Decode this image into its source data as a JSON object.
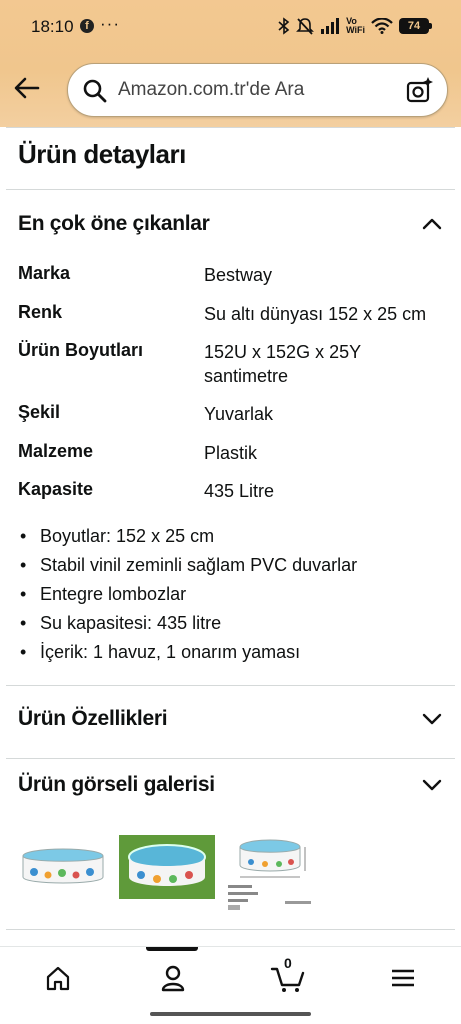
{
  "status_bar": {
    "time": "18:10",
    "app_icon": "f",
    "more": "···",
    "network_label_top": "Vo",
    "network_label_bottom": "WiFi",
    "battery": "74"
  },
  "search": {
    "placeholder": "Amazon.com.tr'de Ara"
  },
  "page": {
    "title": "Ürün detayları"
  },
  "highlights": {
    "title": "En çok öne çıkanlar",
    "specs": [
      {
        "key": "Marka",
        "value": "Bestway"
      },
      {
        "key": "Renk",
        "value": "Su altı dünyası 152 x 25 cm"
      },
      {
        "key": "Ürün Boyutları",
        "value": "152U x 152G x 25Y santimetre"
      },
      {
        "key": "Şekil",
        "value": "Yuvarlak"
      },
      {
        "key": "Malzeme",
        "value": "Plastik"
      },
      {
        "key": "Kapasite",
        "value": "435 Litre"
      }
    ],
    "bullets": [
      "Boyutlar: 152 x 25 cm",
      "Stabil vinil zeminli sağlam PVC duvarlar",
      "Entegre lombozlar",
      "Su kapasitesi: 435 litre",
      "İçerik: 1 havuz, 1 onarım yaması"
    ]
  },
  "features": {
    "title": "Ürün Özellikleri"
  },
  "gallery": {
    "title": "Ürün görseli galerisi"
  },
  "nav": {
    "cart_count": "0"
  },
  "colors": {
    "header_bg": "#f0c68d",
    "text": "#0f1111",
    "divider": "#d5d9d9",
    "pool_water": "#58b6d8",
    "grass": "#5f9a3a"
  },
  "icons": {
    "back": "arrow-left-icon",
    "search": "search-icon",
    "camera": "camera-search-icon",
    "home": "home-icon",
    "account": "person-icon",
    "cart": "cart-icon",
    "menu": "hamburger-menu-icon"
  }
}
